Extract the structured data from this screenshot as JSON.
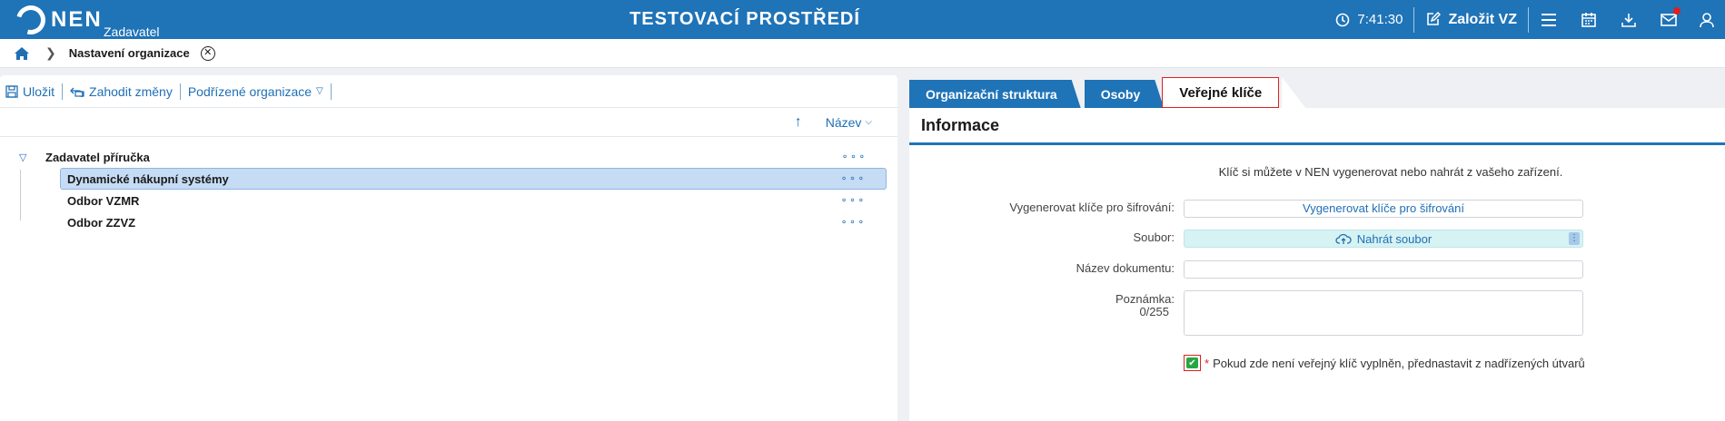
{
  "topbar": {
    "logo_text": "NEN",
    "logo_sub": "Zadavatel",
    "env_title": "TESTOVACÍ PROSTŘEDÍ",
    "time": "7:41:30",
    "create_label": "Založit VZ",
    "icons": [
      "clock-icon",
      "edit-icon",
      "menu-icon",
      "calendar-icon",
      "download-icon",
      "mail-icon",
      "user-icon"
    ],
    "accent_color": "#1f73b7"
  },
  "breadcrumb": {
    "current": "Nastavení organizace"
  },
  "left": {
    "toolbar": {
      "save": "Uložit",
      "discard": "Zahodit změny",
      "sub_orgs": "Podřízené organizace"
    },
    "sort": {
      "label": "Název"
    },
    "tree": {
      "root": "Zadavatel příručka",
      "children": [
        "Dynamické nákupní systémy",
        "Odbor VZMR",
        "Odbor ZZVZ"
      ],
      "selected_index": 0
    }
  },
  "right": {
    "tabs": [
      "Organizační struktura",
      "Osoby",
      "Veřejné klíče"
    ],
    "active_tab": "Veřejné klíče",
    "section_title": "Informace",
    "hint": "Klíč si můžete v NEN vygenerovat nebo nahrát z vašeho zařízení.",
    "form": {
      "generate_label": "Vygenerovat klíče pro šifrování:",
      "generate_button": "Vygenerovat klíče pro šifrování",
      "file_label": "Soubor:",
      "upload_button": "Nahrát soubor",
      "docname_label": "Název dokumentu:",
      "docname_value": "",
      "note_label": "Poznámka:",
      "note_counter": "0/255",
      "note_value": "",
      "checkbox_label": "Pokud zde není veřejný klíč vyplněn, přednastavit z nadřízených útvarů",
      "checkbox_checked": true
    }
  }
}
